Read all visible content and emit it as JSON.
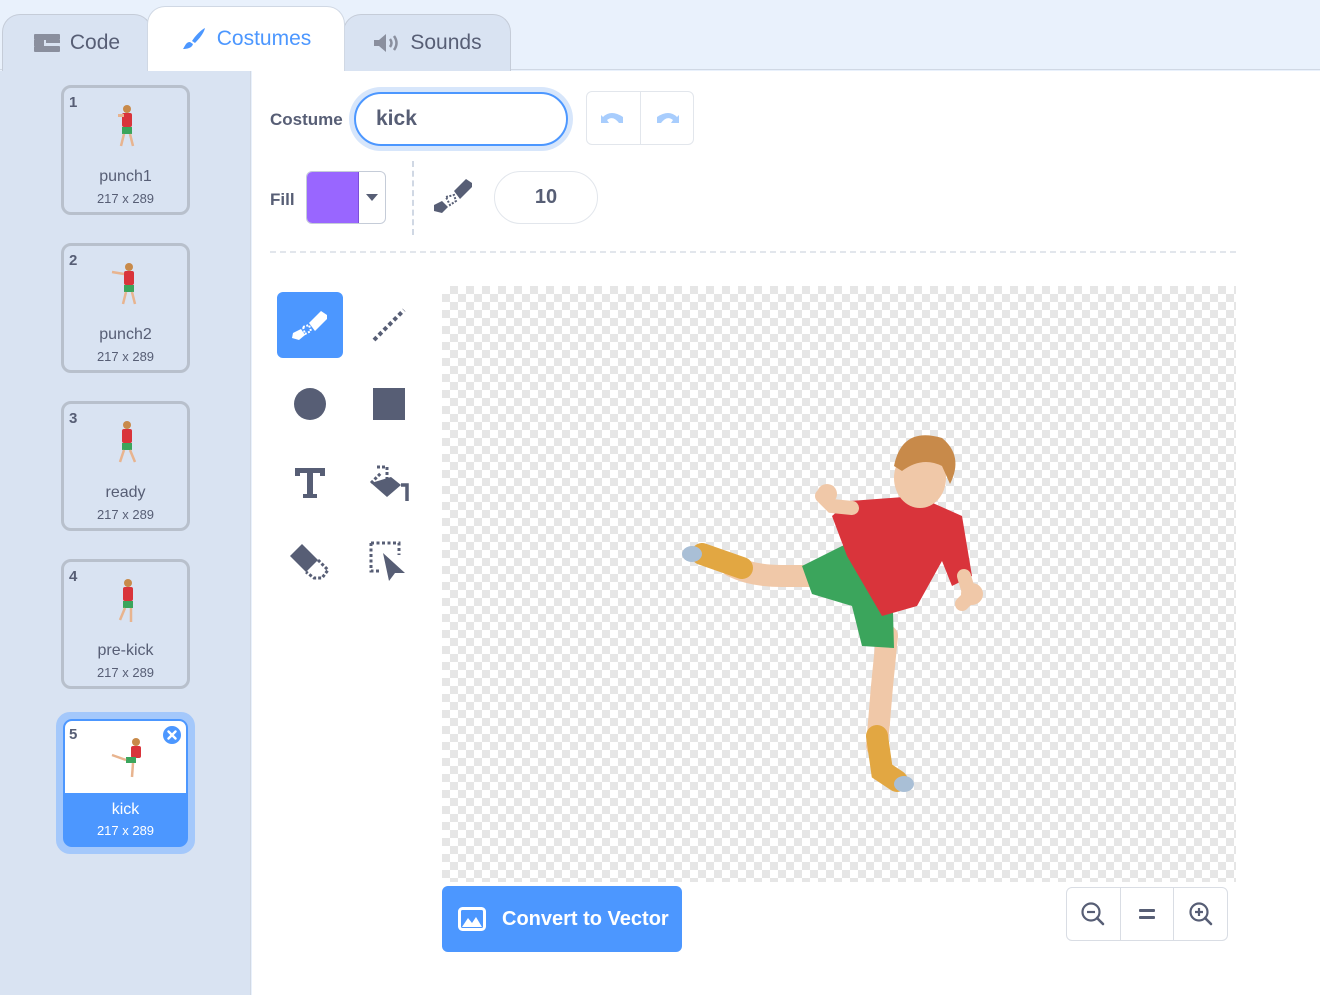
{
  "tabs": [
    {
      "label": "Code",
      "icon": "code-blocks-icon",
      "active": false
    },
    {
      "label": "Costumes",
      "icon": "paintbrush-icon",
      "active": true
    },
    {
      "label": "Sounds",
      "icon": "speaker-icon",
      "active": false
    }
  ],
  "costumes": [
    {
      "number": "1",
      "name": "punch1",
      "size": "217 x 289",
      "selected": false
    },
    {
      "number": "2",
      "name": "punch2",
      "size": "217 x 289",
      "selected": false
    },
    {
      "number": "3",
      "name": "ready",
      "size": "217 x 289",
      "selected": false
    },
    {
      "number": "4",
      "name": "pre-kick",
      "size": "217 x 289",
      "selected": false
    },
    {
      "number": "5",
      "name": "kick",
      "size": "217 x 289",
      "selected": true
    }
  ],
  "editor": {
    "costume_label": "Costume",
    "costume_name": "kick",
    "fill_label": "Fill",
    "fill_color": "#9966ff",
    "brush_size": "10",
    "undo_icon": "undo-icon",
    "redo_icon": "redo-icon",
    "tools": [
      {
        "name": "brush",
        "icon": "brush-icon",
        "active": true
      },
      {
        "name": "line",
        "icon": "line-icon",
        "active": false
      },
      {
        "name": "circle",
        "icon": "circle-icon",
        "active": false
      },
      {
        "name": "rectangle",
        "icon": "rectangle-icon",
        "active": false
      },
      {
        "name": "text",
        "icon": "text-icon",
        "active": false
      },
      {
        "name": "fill",
        "icon": "fill-bucket-icon",
        "active": false
      },
      {
        "name": "eraser",
        "icon": "eraser-icon",
        "active": false
      },
      {
        "name": "select",
        "icon": "select-icon",
        "active": false
      }
    ],
    "convert_label": "Convert to Vector",
    "zoom_controls": [
      "zoom-out-icon",
      "zoom-reset-icon",
      "zoom-in-icon"
    ]
  },
  "colors": {
    "accent": "#4c97ff",
    "text": "#575e75",
    "sidebar_bg": "#d9e3f2",
    "fill": "#9966ff"
  }
}
